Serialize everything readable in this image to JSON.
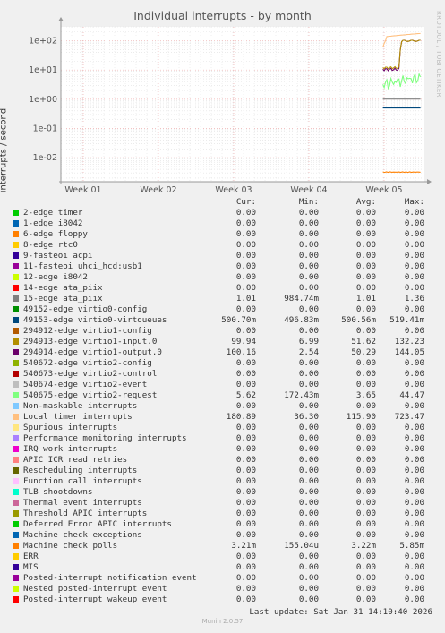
{
  "title": "Individual interrupts - by month",
  "ylabel": "interrupts / second",
  "side_label": "RRDTOOL / TOBI OETIKER",
  "footer": "Munin 2.0.57",
  "last_update": "Last update:  Sat Jan 31 14:10:40 2026",
  "headers": {
    "cur": "Cur:",
    "min": "Min:",
    "avg": "Avg:",
    "max": "Max:"
  },
  "chart_data": {
    "type": "line",
    "title": "Individual interrupts - by month",
    "ylabel": "interrupts / second",
    "yscale": "log",
    "ylim": [
      0.0015,
      300
    ],
    "yticks": [
      "1e-02",
      "1e-01",
      "1e+00",
      "1e+01",
      "1e+02"
    ],
    "xticks": [
      "Week 01",
      "Week 02",
      "Week 03",
      "Week 04",
      "Week 05"
    ],
    "grid": true,
    "series": [
      {
        "name": "2-edge timer",
        "color": "#00cc00",
        "cur": "0.00",
        "min": "0.00",
        "avg": "0.00",
        "max": "0.00"
      },
      {
        "name": "1-edge i8042",
        "color": "#0066b3",
        "cur": "0.00",
        "min": "0.00",
        "avg": "0.00",
        "max": "0.00"
      },
      {
        "name": "6-edge floppy",
        "color": "#ff8000",
        "cur": "0.00",
        "min": "0.00",
        "avg": "0.00",
        "max": "0.00"
      },
      {
        "name": "8-edge rtc0",
        "color": "#ffcc00",
        "cur": "0.00",
        "min": "0.00",
        "avg": "0.00",
        "max": "0.00"
      },
      {
        "name": "9-fasteoi acpi",
        "color": "#330099",
        "cur": "0.00",
        "min": "0.00",
        "avg": "0.00",
        "max": "0.00"
      },
      {
        "name": "11-fasteoi uhci_hcd:usb1",
        "color": "#990099",
        "cur": "0.00",
        "min": "0.00",
        "avg": "0.00",
        "max": "0.00"
      },
      {
        "name": "12-edge i8042",
        "color": "#ccff00",
        "cur": "0.00",
        "min": "0.00",
        "avg": "0.00",
        "max": "0.00"
      },
      {
        "name": "14-edge ata_piix",
        "color": "#ff0000",
        "cur": "0.00",
        "min": "0.00",
        "avg": "0.00",
        "max": "0.00"
      },
      {
        "name": "15-edge ata_piix",
        "color": "#808080",
        "cur": "1.01",
        "min": "984.74m",
        "avg": "1.01",
        "max": "1.36"
      },
      {
        "name": "49152-edge virtio0-config",
        "color": "#008f00",
        "cur": "0.00",
        "min": "0.00",
        "avg": "0.00",
        "max": "0.00"
      },
      {
        "name": "49153-edge virtio0-virtqueues",
        "color": "#00487d",
        "cur": "500.70m",
        "min": "496.83m",
        "avg": "500.56m",
        "max": "519.41m"
      },
      {
        "name": "294912-edge virtio1-config",
        "color": "#b35a00",
        "cur": "0.00",
        "min": "0.00",
        "avg": "0.00",
        "max": "0.00"
      },
      {
        "name": "294913-edge virtio1-input.0",
        "color": "#b38f00",
        "cur": "99.94",
        "min": "6.99",
        "avg": "51.62",
        "max": "132.23"
      },
      {
        "name": "294914-edge virtio1-output.0",
        "color": "#6b006b",
        "cur": "100.16",
        "min": "2.54",
        "avg": "50.29",
        "max": "144.05"
      },
      {
        "name": "540672-edge virtio2-config",
        "color": "#8fb300",
        "cur": "0.00",
        "min": "0.00",
        "avg": "0.00",
        "max": "0.00"
      },
      {
        "name": "540673-edge virtio2-control",
        "color": "#b30000",
        "cur": "0.00",
        "min": "0.00",
        "avg": "0.00",
        "max": "0.00"
      },
      {
        "name": "540674-edge virtio2-event",
        "color": "#bebebe",
        "cur": "0.00",
        "min": "0.00",
        "avg": "0.00",
        "max": "0.00"
      },
      {
        "name": "540675-edge virtio2-request",
        "color": "#80ff80",
        "cur": "5.62",
        "min": "172.43m",
        "avg": "3.65",
        "max": "44.47"
      },
      {
        "name": "Non-maskable interrupts",
        "color": "#80c9ff",
        "cur": "0.00",
        "min": "0.00",
        "avg": "0.00",
        "max": "0.00"
      },
      {
        "name": "Local timer interrupts",
        "color": "#ffc080",
        "cur": "180.89",
        "min": "36.30",
        "avg": "115.90",
        "max": "723.47"
      },
      {
        "name": "Spurious interrupts",
        "color": "#ffe680",
        "cur": "0.00",
        "min": "0.00",
        "avg": "0.00",
        "max": "0.00"
      },
      {
        "name": "Performance monitoring interrupts",
        "color": "#aa80ff",
        "cur": "0.00",
        "min": "0.00",
        "avg": "0.00",
        "max": "0.00"
      },
      {
        "name": "IRQ work interrupts",
        "color": "#ee00cc",
        "cur": "0.00",
        "min": "0.00",
        "avg": "0.00",
        "max": "0.00"
      },
      {
        "name": "APIC ICR read retries",
        "color": "#ff8080",
        "cur": "0.00",
        "min": "0.00",
        "avg": "0.00",
        "max": "0.00"
      },
      {
        "name": "Rescheduling interrupts",
        "color": "#666600",
        "cur": "0.00",
        "min": "0.00",
        "avg": "0.00",
        "max": "0.00"
      },
      {
        "name": "Function call interrupts",
        "color": "#ffbfff",
        "cur": "0.00",
        "min": "0.00",
        "avg": "0.00",
        "max": "0.00"
      },
      {
        "name": "TLB shootdowns",
        "color": "#00ffcc",
        "cur": "0.00",
        "min": "0.00",
        "avg": "0.00",
        "max": "0.00"
      },
      {
        "name": "Thermal event interrupts",
        "color": "#cc6699",
        "cur": "0.00",
        "min": "0.00",
        "avg": "0.00",
        "max": "0.00"
      },
      {
        "name": "Threshold APIC interrupts",
        "color": "#999900",
        "cur": "0.00",
        "min": "0.00",
        "avg": "0.00",
        "max": "0.00"
      },
      {
        "name": "Deferred Error APIC interrupts",
        "color": "#00cc00",
        "cur": "0.00",
        "min": "0.00",
        "avg": "0.00",
        "max": "0.00"
      },
      {
        "name": "Machine check exceptions",
        "color": "#0066b3",
        "cur": "0.00",
        "min": "0.00",
        "avg": "0.00",
        "max": "0.00"
      },
      {
        "name": "Machine check polls",
        "color": "#ff8000",
        "cur": "3.21m",
        "min": "155.04u",
        "avg": "3.22m",
        "max": "5.85m"
      },
      {
        "name": "ERR",
        "color": "#ffcc00",
        "cur": "0.00",
        "min": "0.00",
        "avg": "0.00",
        "max": "0.00"
      },
      {
        "name": "MIS",
        "color": "#330099",
        "cur": "0.00",
        "min": "0.00",
        "avg": "0.00",
        "max": "0.00"
      },
      {
        "name": "Posted-interrupt notification event",
        "color": "#990099",
        "cur": "0.00",
        "min": "0.00",
        "avg": "0.00",
        "max": "0.00"
      },
      {
        "name": "Nested posted-interrupt event",
        "color": "#ccff00",
        "cur": "0.00",
        "min": "0.00",
        "avg": "0.00",
        "max": "0.00"
      },
      {
        "name": "Posted-interrupt wakeup event",
        "color": "#ff0000",
        "cur": "0.00",
        "min": "0.00",
        "avg": "0.00",
        "max": "0.00"
      }
    ]
  }
}
